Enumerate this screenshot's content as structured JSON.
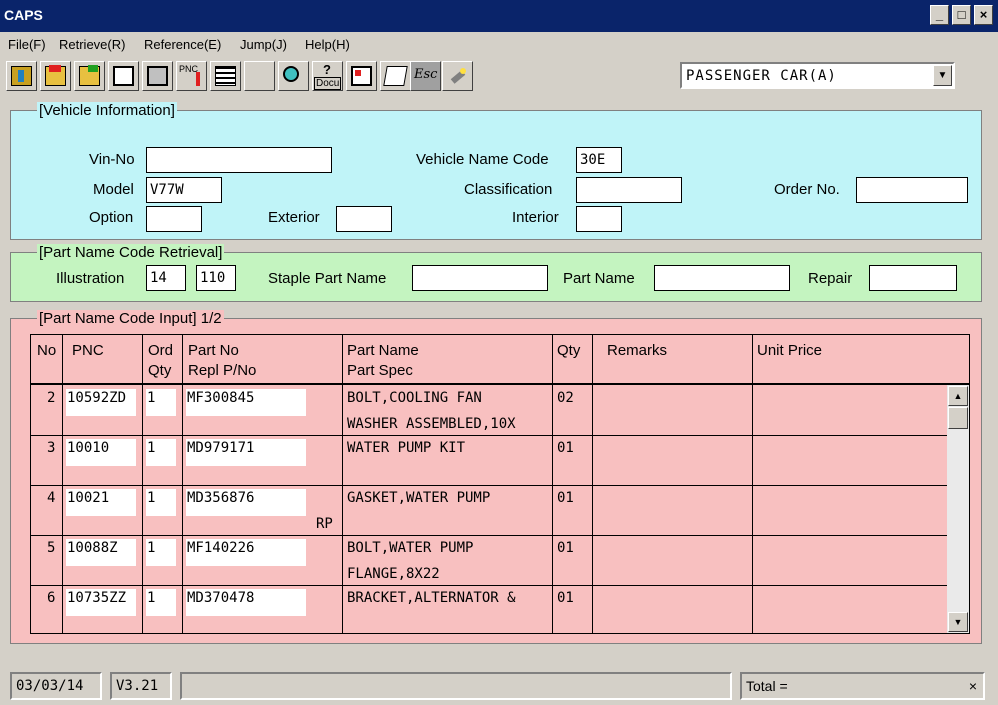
{
  "window": {
    "title": "CAPS"
  },
  "menu": [
    "File(F)",
    "Retrieve(R)",
    "Reference(E)",
    "Jump(J)",
    "Help(H)"
  ],
  "toolbar": {
    "pnc_label": "PNC",
    "docu_label": "Docu",
    "esc_label": "Esc",
    "model_select": "PASSENGER CAR(A)"
  },
  "vehicle": {
    "legend": "[Vehicle Information]",
    "vin_label": "Vin-No",
    "vin_value": "",
    "vehicle_name_code_label": "Vehicle Name Code",
    "vehicle_name_code_value": "30E",
    "model_label": "Model",
    "model_value": "V77W",
    "classification_label": "Classification",
    "classification_value": "",
    "order_label": "Order No.",
    "order_value": "",
    "option_label": "Option",
    "option_value": "",
    "exterior_label": "Exterior",
    "exterior_value": "",
    "interior_label": "Interior",
    "interior_value": ""
  },
  "retrieval": {
    "legend": "[Part Name Code Retrieval]",
    "illustration_label": "Illustration",
    "illustration_value1": "14",
    "illustration_value2": "110",
    "staple_label": "Staple Part Name",
    "staple_value": "",
    "part_name_label": "Part Name",
    "part_name_value": "",
    "repair_label": "Repair",
    "repair_value": ""
  },
  "input": {
    "legend": "[Part Name Code Input] 1/2",
    "headers": {
      "no": "No",
      "pnc": "PNC",
      "ord": "Ord",
      "qty_sub": "Qty",
      "part_no": "Part No",
      "repl": "Repl P/No",
      "part_name": "Part Name",
      "part_spec": "Part Spec",
      "qty": "Qty",
      "remarks": "Remarks",
      "unit_price": "Unit Price"
    },
    "rows": [
      {
        "no": "2",
        "pnc": "10592ZD",
        "ord": "1",
        "part_no": "MF300845",
        "repl": "",
        "name": "BOLT,COOLING FAN",
        "spec": "WASHER ASSEMBLED,10X",
        "qty": "02"
      },
      {
        "no": "3",
        "pnc": "10010",
        "ord": "1",
        "part_no": "MD979171",
        "repl": "",
        "name": "WATER PUMP KIT",
        "spec": "",
        "qty": "01"
      },
      {
        "no": "4",
        "pnc": "10021",
        "ord": "1",
        "part_no": "MD356876",
        "repl": "RP",
        "name": "GASKET,WATER PUMP",
        "spec": "",
        "qty": "01"
      },
      {
        "no": "5",
        "pnc": "10088Z",
        "ord": "1",
        "part_no": "MF140226",
        "repl": "",
        "name": "BOLT,WATER PUMP",
        "spec": "FLANGE,8X22",
        "qty": "01"
      },
      {
        "no": "6",
        "pnc": "10735ZZ",
        "ord": "1",
        "part_no": "MD370478",
        "repl": "",
        "name": "BRACKET,ALTERNATOR &",
        "spec": "",
        "qty": "01"
      }
    ]
  },
  "status": {
    "date": "03/03/14",
    "version": "V3.21",
    "message": "",
    "total_label": "Total =",
    "close_mark": "×"
  },
  "colors": {
    "vehicle_bg": "#c0f4f8",
    "retrieval_bg": "#c4f4c0",
    "input_bg": "#f8c0c0",
    "title_bg": "#0a246a"
  }
}
